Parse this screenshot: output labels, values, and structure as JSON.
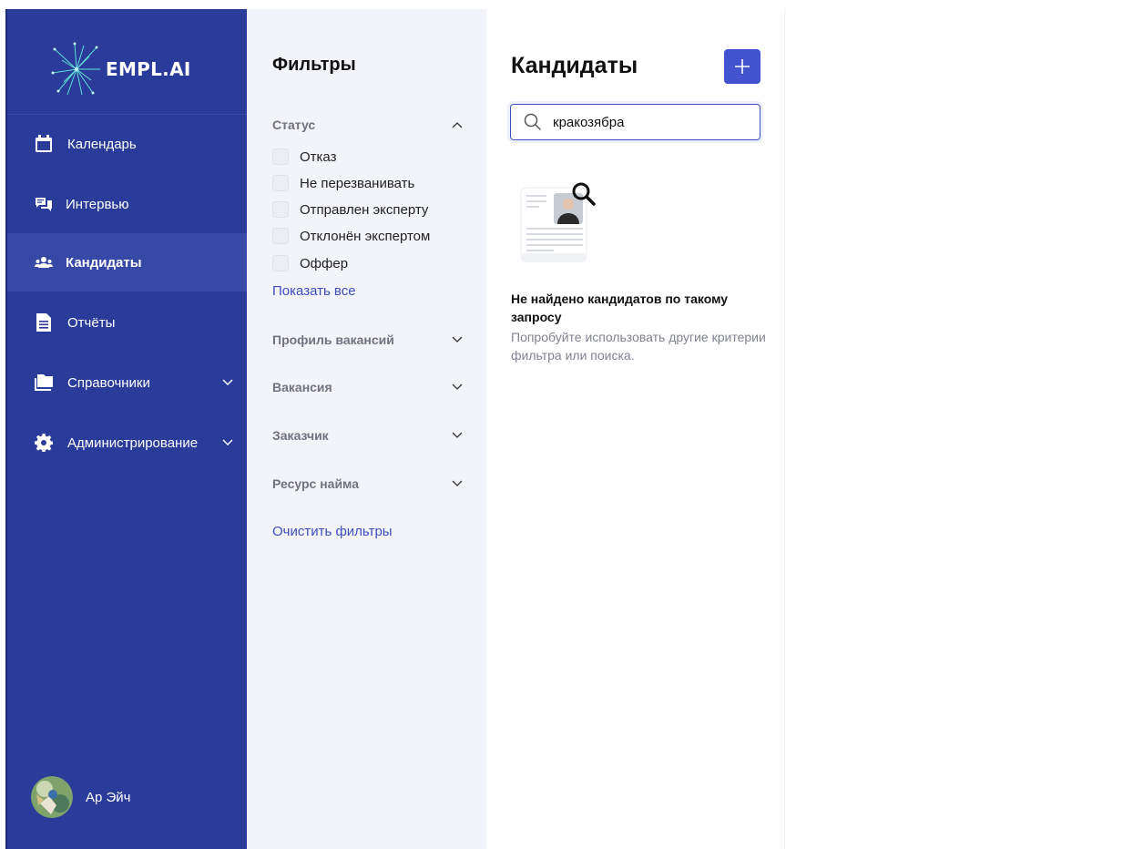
{
  "logo": {
    "text": "EMPL.AI"
  },
  "sidebar": {
    "items": [
      {
        "label": "Календарь",
        "icon": "calendar-icon"
      },
      {
        "label": "Интервью",
        "icon": "chat-icon"
      },
      {
        "label": "Кандидаты",
        "icon": "users-icon",
        "active": true
      },
      {
        "label": "Отчёты",
        "icon": "document-icon"
      },
      {
        "label": "Справочники",
        "icon": "folder-icon",
        "expandable": true
      },
      {
        "label": "Администрирование",
        "icon": "gear-icon",
        "expandable": true
      }
    ],
    "user": {
      "name": "Ар Эйч",
      "icon": "avatar"
    }
  },
  "filters": {
    "title": "Фильтры",
    "status": {
      "label": "Статус",
      "options": [
        "Отказ",
        "Не перезванивать",
        "Отправлен эксперту",
        "Отклонён экспертом",
        "Оффер"
      ],
      "show_all": "Показать все"
    },
    "sections": [
      "Профиль вакансий",
      "Вакансия",
      "Заказчик",
      "Ресурс найма"
    ],
    "clear": "Очистить фильтры"
  },
  "main": {
    "title": "Кандидаты",
    "add_icon": "plus-icon",
    "search": {
      "value": "кракозябра",
      "icon": "search-icon"
    },
    "empty": {
      "title": "Не найдено кандидатов по такому запросу",
      "subtitle": "Попробуйте использовать другие критерии фильтра или поиска."
    }
  },
  "colors": {
    "sidebar_bg": "#2b3b9a",
    "sidebar_active": "#3848a6",
    "filters_bg": "#f3f4f9",
    "accent": "#4253d0",
    "link": "#3d4dbb"
  }
}
